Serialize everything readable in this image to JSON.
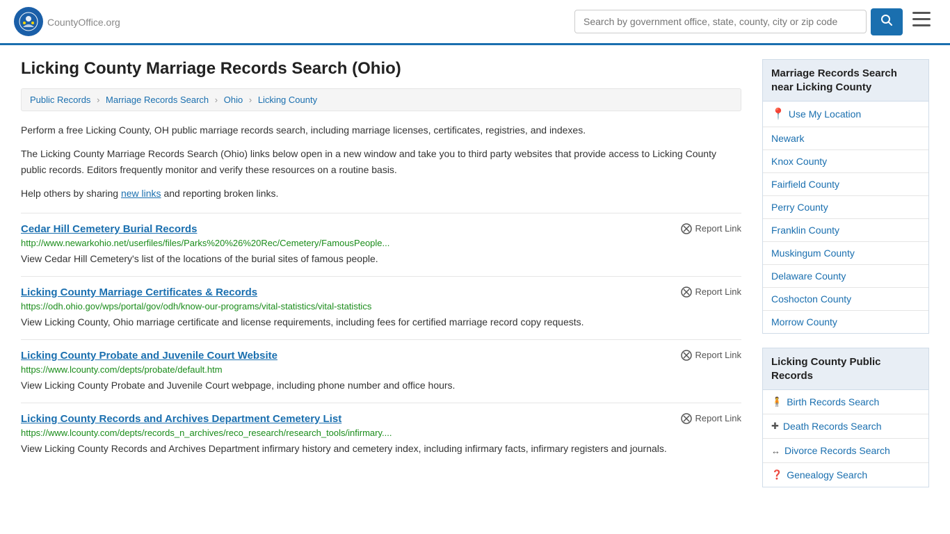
{
  "header": {
    "logo_text": "CountyOffice",
    "logo_suffix": ".org",
    "search_placeholder": "Search by government office, state, county, city or zip code",
    "search_button_label": "🔍"
  },
  "page": {
    "title": "Licking County Marriage Records Search (Ohio)",
    "breadcrumbs": [
      {
        "label": "Public Records",
        "href": "#"
      },
      {
        "label": "Marriage Records Search",
        "href": "#"
      },
      {
        "label": "Ohio",
        "href": "#"
      },
      {
        "label": "Licking County",
        "href": "#"
      }
    ],
    "desc1": "Perform a free Licking County, OH public marriage records search, including marriage licenses, certificates, registries, and indexes.",
    "desc2": "The Licking County Marriage Records Search (Ohio) links below open in a new window and take you to third party websites that provide access to Licking County public records. Editors frequently monitor and verify these resources on a routine basis.",
    "desc3_pre": "Help others by sharing ",
    "desc3_link": "new links",
    "desc3_post": " and reporting broken links."
  },
  "results": [
    {
      "title": "Cedar Hill Cemetery Burial Records",
      "url": "http://www.newarkohio.net/userfiles/files/Parks%20%26%20Rec/Cemetery/FamousPeople...",
      "desc": "View Cedar Hill Cemetery's list of the locations of the burial sites of famous people.",
      "report_label": "Report Link"
    },
    {
      "title": "Licking County Marriage Certificates & Records",
      "url": "https://odh.ohio.gov/wps/portal/gov/odh/know-our-programs/vital-statistics/vital-statistics",
      "desc": "View Licking County, Ohio marriage certificate and license requirements, including fees for certified marriage record copy requests.",
      "report_label": "Report Link"
    },
    {
      "title": "Licking County Probate and Juvenile Court Website",
      "url": "https://www.lcounty.com/depts/probate/default.htm",
      "desc": "View Licking County Probate and Juvenile Court webpage, including phone number and office hours.",
      "report_label": "Report Link"
    },
    {
      "title": "Licking County Records and Archives Department Cemetery List",
      "url": "https://www.lcounty.com/depts/records_n_archives/reco_research/research_tools/infirmary....",
      "desc": "View Licking County Records and Archives Department infirmary history and cemetery index, including infirmary facts, infirmary registers and journals.",
      "report_label": "Report Link"
    }
  ],
  "sidebar": {
    "nearby_title": "Marriage Records Search near Licking County",
    "use_location_label": "Use My Location",
    "nearby_items": [
      {
        "label": "Newark"
      },
      {
        "label": "Knox County"
      },
      {
        "label": "Fairfield County"
      },
      {
        "label": "Perry County"
      },
      {
        "label": "Franklin County"
      },
      {
        "label": "Muskingum County"
      },
      {
        "label": "Delaware County"
      },
      {
        "label": "Coshocton County"
      },
      {
        "label": "Morrow County"
      }
    ],
    "public_records_title": "Licking County Public Records",
    "public_records_items": [
      {
        "icon": "🧍",
        "label": "Birth Records Search"
      },
      {
        "icon": "✚",
        "label": "Death Records Search"
      },
      {
        "icon": "↔",
        "label": "Divorce Records Search"
      },
      {
        "icon": "❓",
        "label": "Genealogy Search"
      }
    ]
  }
}
